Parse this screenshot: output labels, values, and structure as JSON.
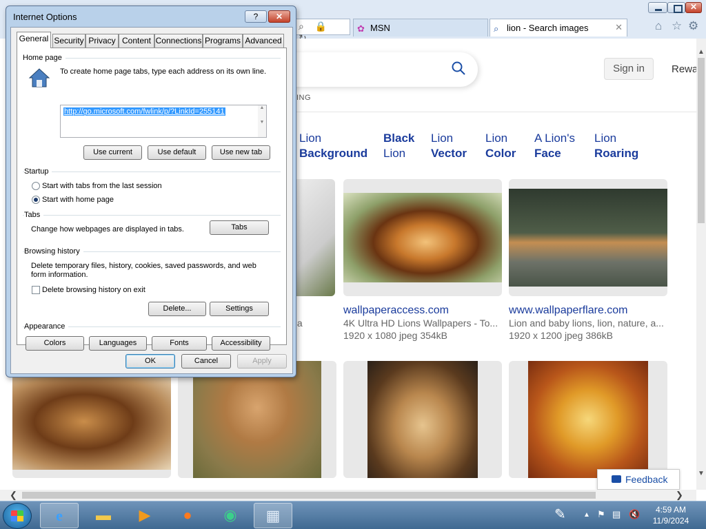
{
  "browser": {
    "addr_tail_glyphs": "⌕ 🔒 ↻",
    "tabs": [
      {
        "label": "MSN"
      },
      {
        "label": "lion - Search images"
      }
    ]
  },
  "page": {
    "sign_in": "Sign in",
    "rewards": "Rewa",
    "scope_partial": "ING",
    "suggestions": [
      {
        "line1": "Lion",
        "line2": "Background",
        "bold": 2
      },
      {
        "line1": "Black",
        "line2": "Lion",
        "bold": 1
      },
      {
        "line1": "Lion",
        "line2": "Vector",
        "bold": 2
      },
      {
        "line1": "Lion",
        "line2": "Color",
        "bold": 2
      },
      {
        "line1": "A Lion's",
        "line2": "Face",
        "bold": 2
      },
      {
        "line1": "Lion",
        "line2": "Roaring",
        "bold": 2
      }
    ],
    "results": [
      {
        "site": "wallpaperaccess.com",
        "desc": "4K Ultra HD Lions Wallpapers - To...",
        "meta": "1920 x 1080 jpeg 354kB"
      },
      {
        "site": "www.wallpaperflare.com",
        "desc": "Lion and baby lions, lion, nature, a...",
        "meta": "1920 x 1200 jpeg 386kB"
      }
    ],
    "partial_desc": "dia",
    "feedback": "Feedback"
  },
  "dialog": {
    "title": "Internet Options",
    "help": "?",
    "tabs": [
      "General",
      "Security",
      "Privacy",
      "Content",
      "Connections",
      "Programs",
      "Advanced"
    ],
    "home_page": {
      "heading": "Home page",
      "instruction": "To create home page tabs, type each address on its own line.",
      "url": "http://go.microsoft.com/fwlink/p/?LinkId=255141",
      "buttons": [
        "Use current",
        "Use default",
        "Use new tab"
      ]
    },
    "startup": {
      "heading": "Startup",
      "options": [
        "Start with tabs from the last session",
        "Start with home page"
      ],
      "selected": 1
    },
    "tabs_group": {
      "heading": "Tabs",
      "text": "Change how webpages are displayed in tabs.",
      "button": "Tabs"
    },
    "history": {
      "heading": "Browsing history",
      "text_line1": "Delete temporary files, history, cookies, saved passwords, and web",
      "text_line2": "form information.",
      "checkbox": "Delete browsing history on exit",
      "checked": false,
      "buttons": [
        "Delete...",
        "Settings"
      ]
    },
    "appearance": {
      "heading": "Appearance",
      "buttons": [
        "Colors",
        "Languages",
        "Fonts",
        "Accessibility"
      ]
    },
    "footer": [
      "OK",
      "Cancel",
      "Apply"
    ]
  },
  "taskbar": {
    "time": "4:59 AM",
    "date": "11/9/2024"
  }
}
